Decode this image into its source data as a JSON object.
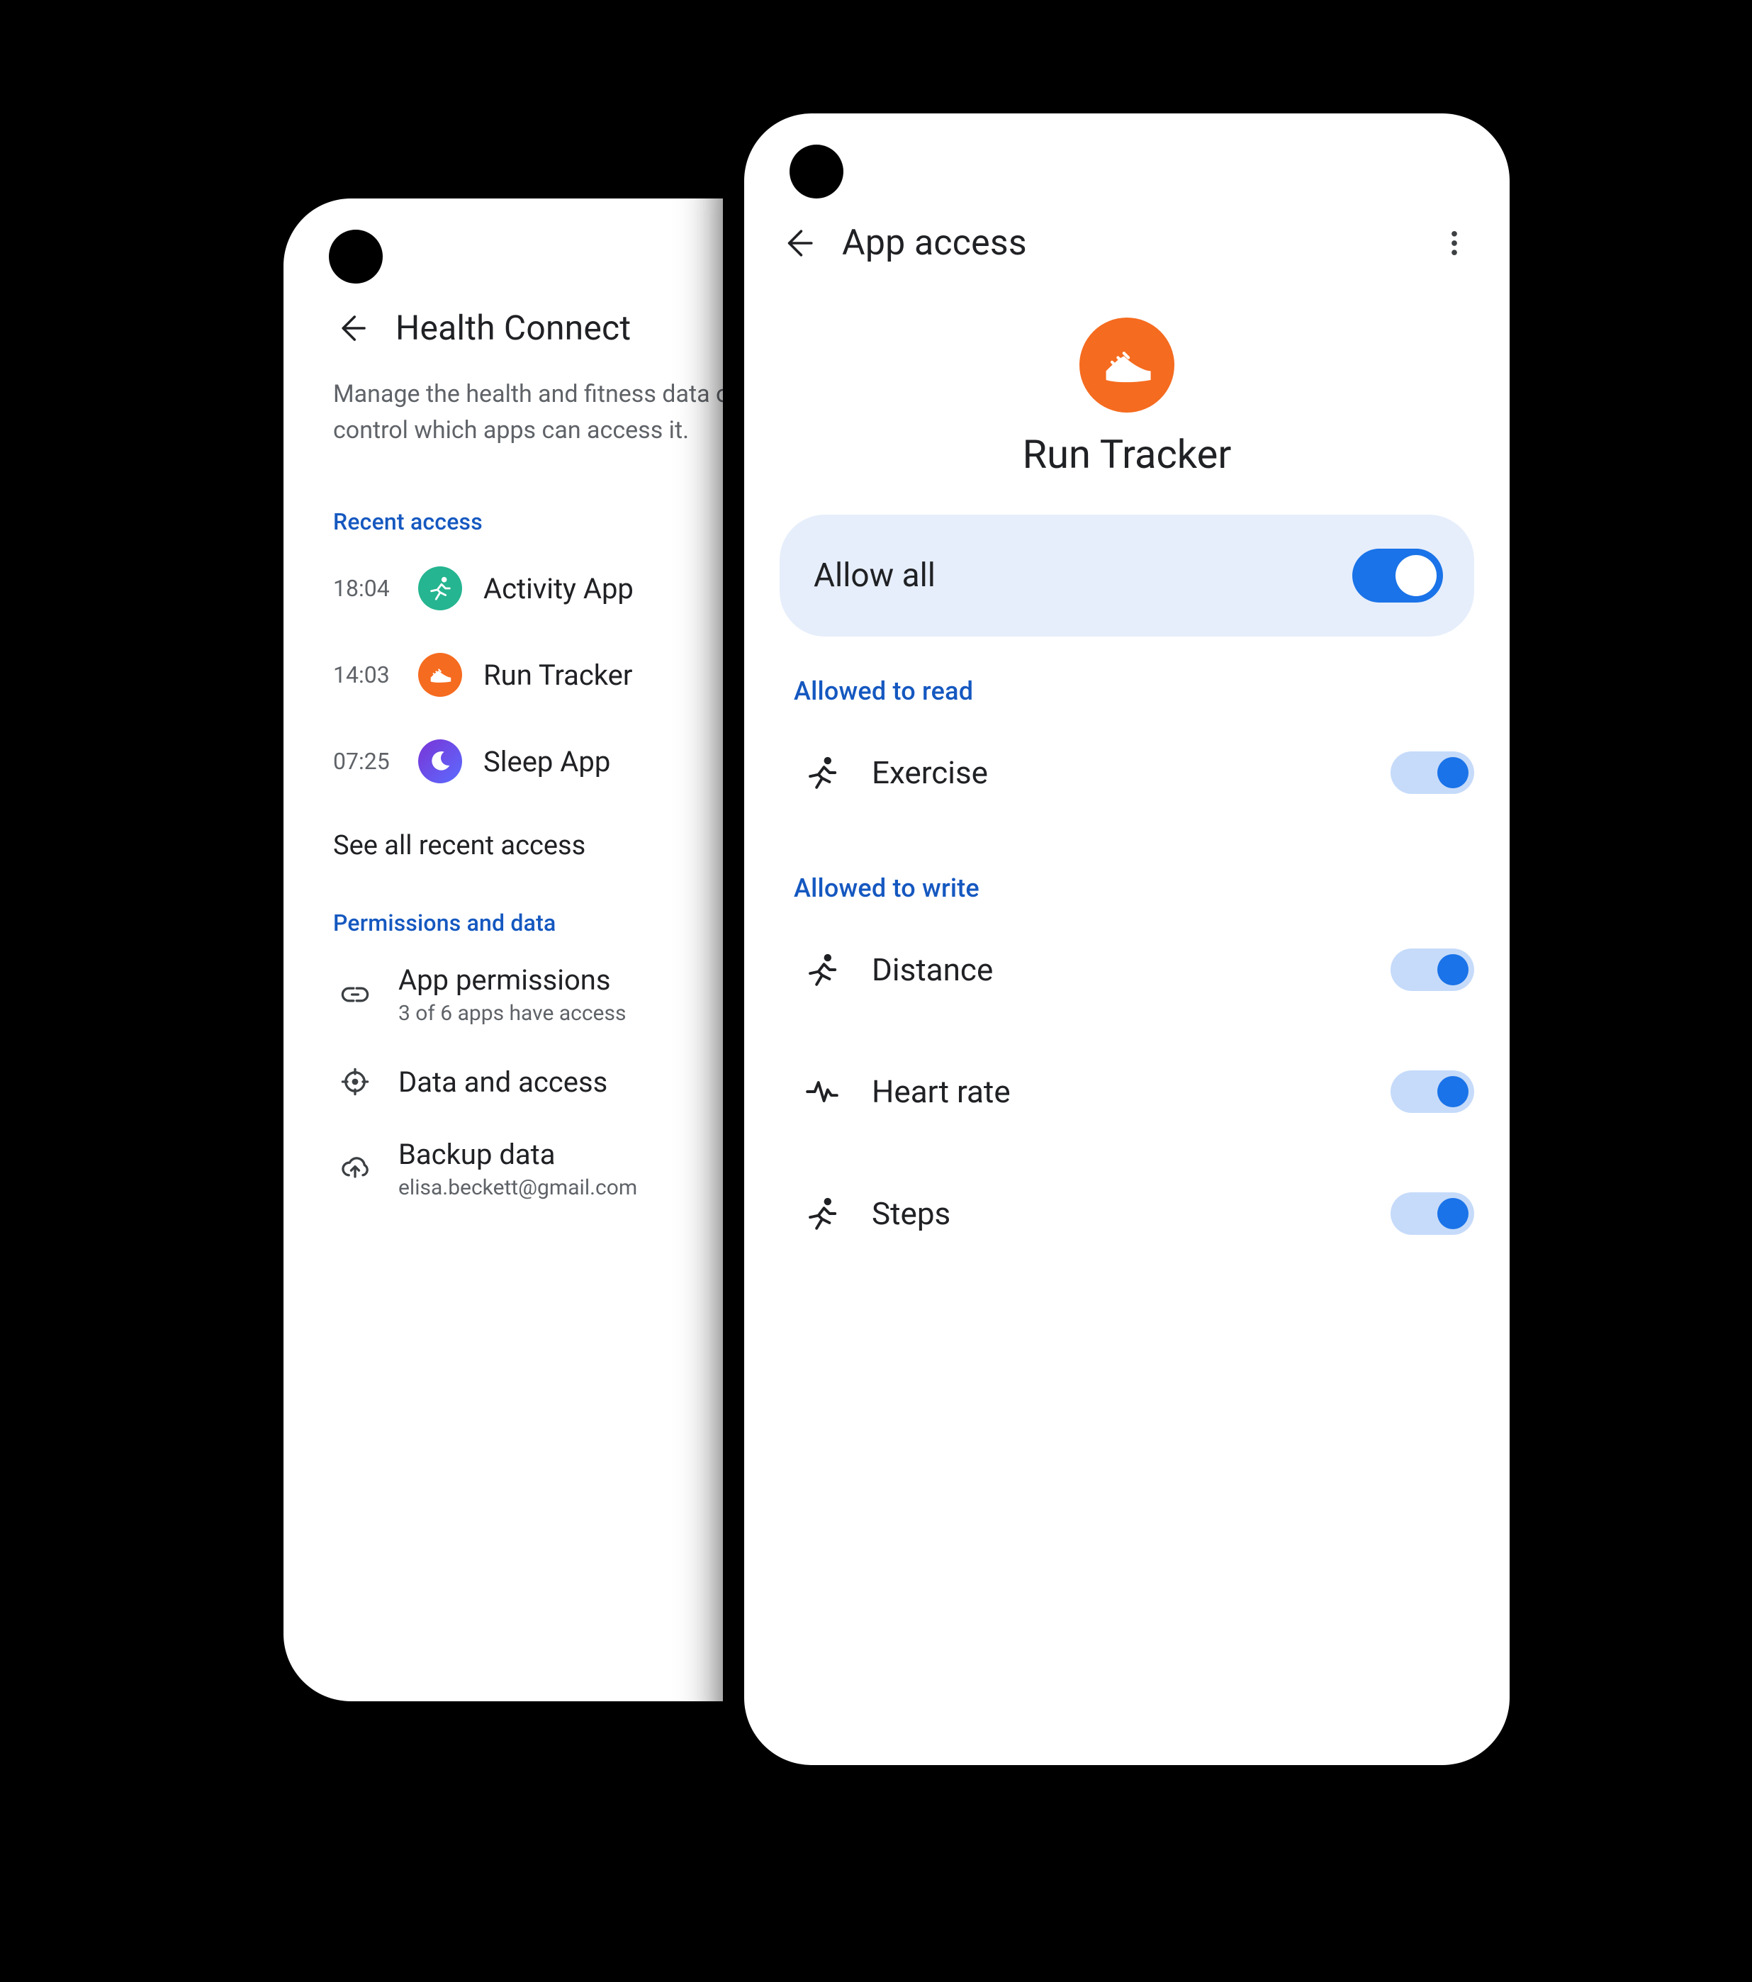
{
  "back": {
    "title": "Health Connect",
    "description": "Manage the health and fitness data on your phone, and control which apps can access it.",
    "recent_label": "Recent access",
    "recent": [
      {
        "time": "18:04",
        "name": "Activity App",
        "icon_style": "teal",
        "icon": "running"
      },
      {
        "time": "14:03",
        "name": "Run Tracker",
        "icon_style": "orange",
        "icon": "shoe"
      },
      {
        "time": "07:25",
        "name": "Sleep App",
        "icon_style": "purple",
        "icon": "moon"
      }
    ],
    "see_all": "See all recent access",
    "perm_label": "Permissions and data",
    "items": [
      {
        "title": "App permissions",
        "sub": "3 of 6 apps have access",
        "icon": "link"
      },
      {
        "title": "Data and access",
        "sub": "",
        "icon": "target"
      },
      {
        "title": "Backup data",
        "sub": "elisa.beckett@gmail.com",
        "icon": "cloud-up"
      }
    ]
  },
  "front": {
    "title": "App access",
    "app_name": "Run Tracker",
    "allow_all": "Allow all",
    "read_label": "Allowed to read",
    "read": [
      {
        "name": "Exercise",
        "icon": "running"
      }
    ],
    "write_label": "Allowed to write",
    "write": [
      {
        "name": "Distance",
        "icon": "running"
      },
      {
        "name": "Heart rate",
        "icon": "heartbeat"
      },
      {
        "name": "Steps",
        "icon": "running"
      }
    ]
  }
}
